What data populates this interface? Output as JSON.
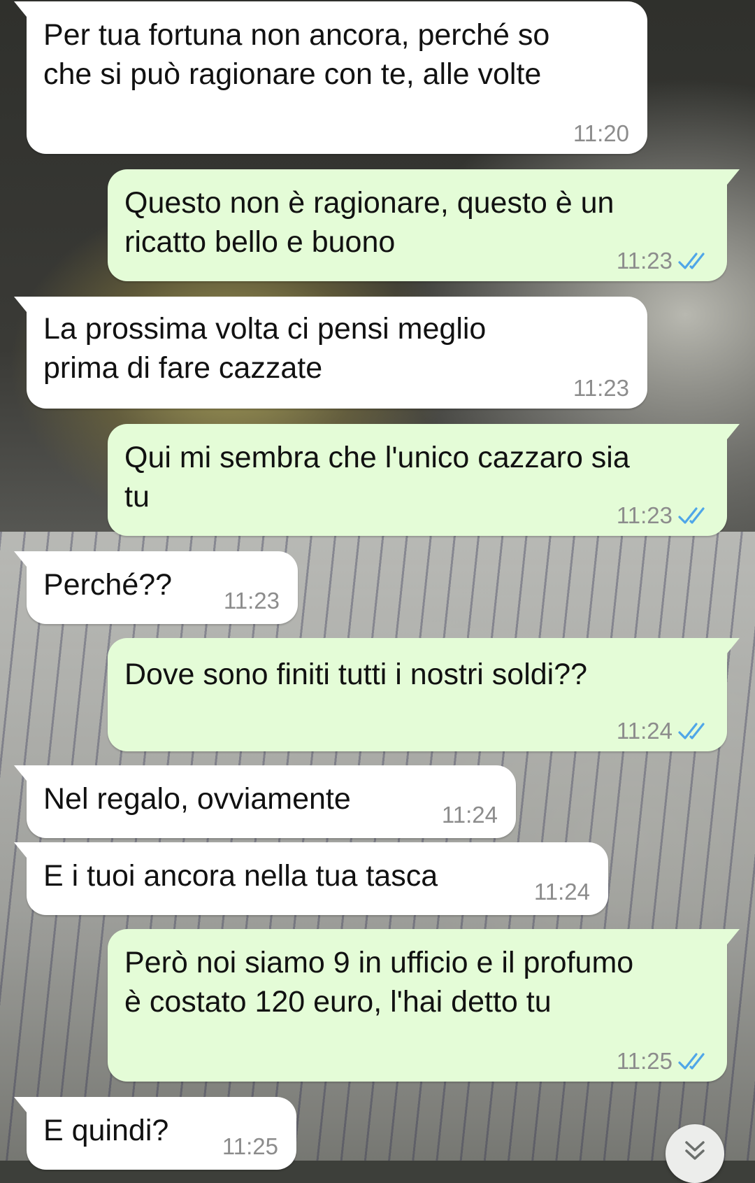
{
  "messages": [
    {
      "side": "incoming",
      "text": "Per tua fortuna non ancora, perché so\nche si può ragionare con te, alle volte",
      "time": "11:20"
    },
    {
      "side": "outgoing",
      "text": "Questo non è ragionare, questo è un\nricatto bello e buono",
      "time": "11:23",
      "status": "read"
    },
    {
      "side": "incoming",
      "text": "La prossima volta ci pensi meglio\nprima di fare cazzate",
      "time": "11:23"
    },
    {
      "side": "outgoing",
      "text": "Qui mi sembra che l'unico cazzaro sia\ntu",
      "time": "11:23",
      "status": "read"
    },
    {
      "side": "incoming",
      "text": "Perché??",
      "time": "11:23"
    },
    {
      "side": "outgoing",
      "text": "Dove sono finiti tutti i nostri soldi??",
      "time": "11:24",
      "status": "read"
    },
    {
      "side": "incoming",
      "text": "Nel regalo, ovviamente",
      "time": "11:24"
    },
    {
      "side": "incoming",
      "text": "E i tuoi ancora nella tua tasca",
      "time": "11:24"
    },
    {
      "side": "outgoing",
      "text": "Però noi siamo 9 in ufficio e il profumo\nè costato 120 euro, l'hai detto tu",
      "time": "11:25",
      "status": "read"
    },
    {
      "side": "incoming",
      "text": "E quindi?",
      "time": "11:25"
    }
  ],
  "icons": {
    "read_receipt": "double-check-icon",
    "scroll_down": "double-chevron-down-icon"
  },
  "colors": {
    "incoming_bubble": "#ffffff",
    "outgoing_bubble": "#e4fcd7",
    "read_ticks": "#4fa6e8",
    "timestamp": "#8c8c8c"
  }
}
